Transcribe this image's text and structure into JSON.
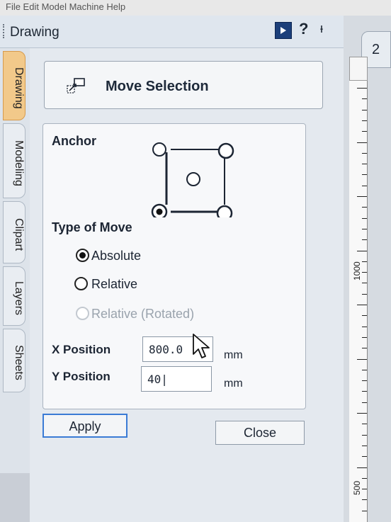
{
  "menubar": {
    "text": "File   Edit   Model   Machine   Help"
  },
  "panel": {
    "title": "Drawing",
    "icons": [
      "pin-panel-icon",
      "help-icon",
      "pushpin-icon"
    ],
    "help_glyph": "?",
    "pushpin_glyph": "ᵼ"
  },
  "tabs": [
    "Drawing",
    "Modeling",
    "Clipart",
    "Layers",
    "Sheets"
  ],
  "active_tab": "Drawing",
  "header": {
    "title": "Move Selection",
    "icon": "move-selection-icon"
  },
  "anchor": {
    "label": "Anchor",
    "selected": "bottom-left"
  },
  "type_of_move": {
    "label": "Type of Move",
    "options": [
      {
        "label": "Absolute",
        "checked": true,
        "enabled": true
      },
      {
        "label": "Relative",
        "checked": false,
        "enabled": true
      },
      {
        "label": "Relative (Rotated)",
        "checked": false,
        "enabled": false
      }
    ]
  },
  "x_position": {
    "label": "X Position",
    "value": "800.0",
    "unit": "mm"
  },
  "y_position": {
    "label": "Y Position",
    "value": "40|",
    "unit": "mm"
  },
  "buttons": {
    "apply": "Apply",
    "close": "Close"
  },
  "document": {
    "tab_label": "2",
    "ruler_labels": [
      "1000",
      "500"
    ]
  },
  "colors": {
    "active_tab": "#f2c98a",
    "primary_button_border": "#3a7bd5",
    "pin_button": "#1c3f7a"
  }
}
